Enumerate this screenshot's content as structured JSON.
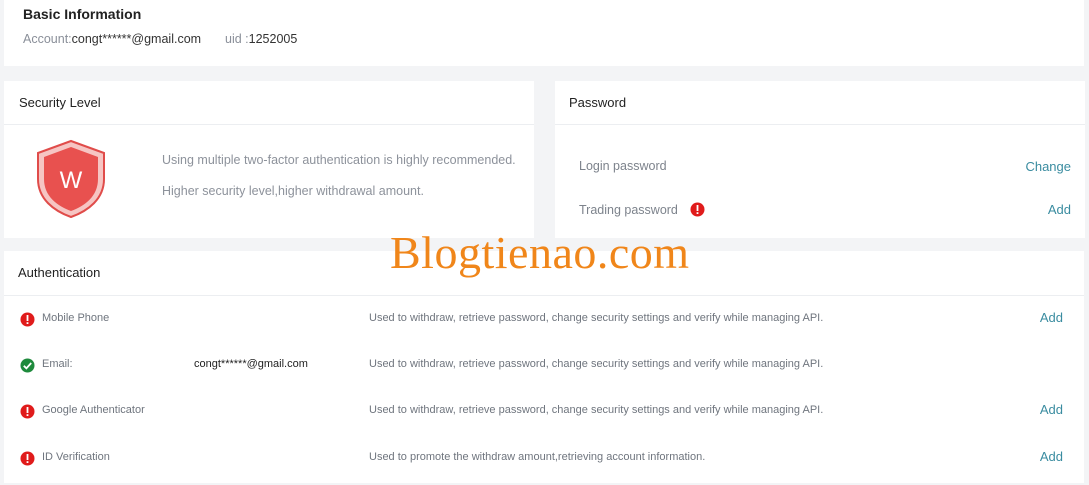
{
  "basic_info": {
    "title": "Basic Information",
    "account_label": "Account:",
    "account_value": "congt******@gmail.com",
    "uid_label": "uid :",
    "uid_value": "1252005"
  },
  "security_level": {
    "title": "Security Level",
    "badge_letter": "W",
    "line1": "Using multiple two-factor authentication is highly recommended.",
    "line2": "Higher security level,higher withdrawal amount.",
    "shield_color": "#e8514f"
  },
  "password": {
    "title": "Password",
    "rows": [
      {
        "label": "Login password",
        "action": "Change",
        "warning": false
      },
      {
        "label": "Trading password",
        "action": "Add",
        "warning": true
      }
    ]
  },
  "authentication": {
    "title": "Authentication",
    "rows": [
      {
        "name": "Mobile Phone",
        "status": "warning",
        "value": "",
        "description": "Used to withdraw, retrieve password, change security settings and verify while managing API.",
        "action": "Add"
      },
      {
        "name": "Email:",
        "status": "verified",
        "value": "congt******@gmail.com",
        "description": "Used to withdraw, retrieve password, change security settings and verify while managing API.",
        "action": ""
      },
      {
        "name": "Google Authenticator",
        "status": "warning",
        "value": "",
        "description": "Used to withdraw, retrieve password, change security settings and verify while managing API.",
        "action": "Add"
      },
      {
        "name": "ID Verification",
        "status": "warning",
        "value": "",
        "description": "Used to promote the withdraw amount,retrieving account information.",
        "action": "Add"
      }
    ]
  },
  "watermark": "Blogtienao.com",
  "colors": {
    "accent_link": "#3a8ca0",
    "warning_red": "#e01b1b",
    "success_green": "#1e8a3c",
    "watermark_orange": "#f0861a"
  }
}
